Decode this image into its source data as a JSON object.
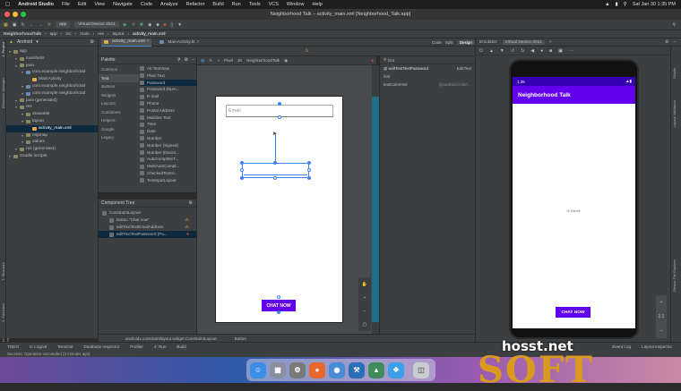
{
  "menubar": {
    "app_name": "Android Studio",
    "items": [
      "File",
      "Edit",
      "View",
      "Navigate",
      "Code",
      "Analyze",
      "Refactor",
      "Build",
      "Run",
      "Tools",
      "VCS",
      "Window",
      "Help"
    ],
    "datetime": "Sat Jan 30  1:35 PM"
  },
  "window": {
    "title": "Neighborhood Talk – activity_main.xml [Neighborhood_Talk.app]"
  },
  "toolbar": {
    "module": "app",
    "device": "Virtual Device 2021"
  },
  "breadcrumbs": [
    "NeighborhoodTalk",
    "app",
    "src",
    "main",
    "res",
    "layout",
    "activity_main.xml"
  ],
  "project": {
    "view_label": "Android",
    "tree": [
      {
        "label": "app",
        "indent": 0,
        "kind": "folder"
      },
      {
        "label": "manifests",
        "indent": 1,
        "kind": "folder"
      },
      {
        "label": "java",
        "indent": 1,
        "kind": "folder"
      },
      {
        "label": "com.example.neighborhood",
        "indent": 2,
        "kind": "pkg"
      },
      {
        "label": "MainActivity",
        "indent": 3,
        "kind": "file"
      },
      {
        "label": "com.example.neighborhood",
        "indent": 2,
        "kind": "pkg"
      },
      {
        "label": "com.example.neighborhood",
        "indent": 2,
        "kind": "pkg"
      },
      {
        "label": "java (generated)",
        "indent": 1,
        "kind": "folder"
      },
      {
        "label": "res",
        "indent": 1,
        "kind": "folder"
      },
      {
        "label": "drawable",
        "indent": 2,
        "kind": "folder"
      },
      {
        "label": "layout",
        "indent": 2,
        "kind": "folder"
      },
      {
        "label": "activity_main.xml",
        "indent": 3,
        "kind": "file",
        "selected": true
      },
      {
        "label": "mipmap",
        "indent": 2,
        "kind": "folder"
      },
      {
        "label": "values",
        "indent": 2,
        "kind": "folder"
      },
      {
        "label": "res (generated)",
        "indent": 1,
        "kind": "folder"
      },
      {
        "label": "Gradle Scripts",
        "indent": 0,
        "kind": "folder"
      }
    ]
  },
  "editor_tabs": [
    {
      "label": "activity_main.xml",
      "active": true
    },
    {
      "label": "MainActivity.kt",
      "active": false
    }
  ],
  "view_modes": [
    "Code",
    "Split",
    "Design"
  ],
  "palette": {
    "title": "Palette",
    "categories": [
      "Common",
      "Text",
      "Buttons",
      "Widgets",
      "Layouts",
      "Containers",
      "Helpers",
      "Google",
      "Legacy"
    ],
    "selected_category": "Text",
    "items": [
      "Ab TextView",
      "Plain Text",
      "Password",
      "Password (Num...",
      "E-mail",
      "Phone",
      "Postal Address",
      "Multiline Text",
      "Time",
      "Date",
      "Number",
      "Number (Signed)",
      "Number (Decim...",
      "AutoCompleteT...",
      "MultiAutoCompl...",
      "CheckedTextVi...",
      "TextInputLayout"
    ]
  },
  "component_tree": {
    "title": "Component Tree",
    "items": [
      {
        "label": "ConstraintLayout",
        "indent": 0,
        "status": ""
      },
      {
        "label": "button  \"Chat now\"",
        "indent": 1,
        "status": "warn"
      },
      {
        "label": "editTextTextEmailAddress",
        "indent": 1,
        "status": "warn"
      },
      {
        "label": "editTextTextPassword  (Pa...",
        "indent": 1,
        "status": "error",
        "selected": true
      }
    ]
  },
  "design_toolbar": {
    "device": "Pixel",
    "api": "30",
    "theme": "NeighborhoodTalk"
  },
  "design": {
    "email_hint": "Email",
    "button_label": "CHAT NOW"
  },
  "attributes": {
    "search": "hint",
    "component": "editTextTextPassword",
    "component_type": "EditText",
    "rows": [
      {
        "name": "hint",
        "value": ""
      },
      {
        "name": "textColorHint",
        "value": "@android:color/..."
      }
    ]
  },
  "status_crumb": [
    "androidx.constraintlayout.widget.ConstraintLayout",
    "Button"
  ],
  "bottom_tools": [
    "TODO",
    "6: Logcat",
    "Terminal",
    "Database Inspector",
    "Profiler",
    "4: Run",
    "Build"
  ],
  "bottom_right": [
    "Event Log",
    "Layout Inspector"
  ],
  "status_message": "Success: Operation succeeded (3 minutes ago)",
  "emulator": {
    "title": "Emulator:",
    "device": "Virtual Device 2021",
    "time": "1:35",
    "app_title": "Neighborhood Talk",
    "hint_text": "Hi Dorrell",
    "button_label": "CHAT NOW"
  },
  "dock_apps": [
    "Finder",
    "Launchpad",
    "System Preferences",
    "Firefox",
    "Chrome",
    "Xcode",
    "Android Studio",
    "Safari",
    "Trash"
  ],
  "watermark": {
    "top": "hosst.net",
    "bottom": "SOFT"
  }
}
